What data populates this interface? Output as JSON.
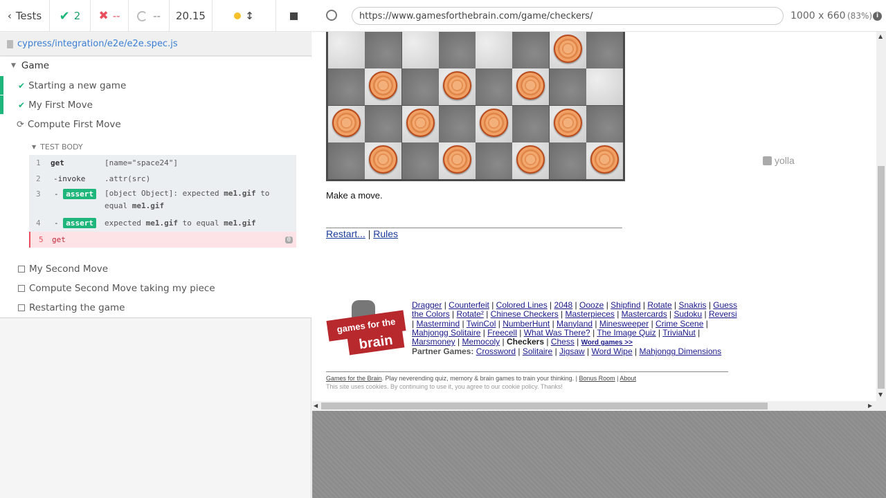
{
  "runner": {
    "tests_label": "Tests",
    "passed_count": "2",
    "failed_count": "--",
    "pending_count": "--",
    "duration": "20.15",
    "spec_path": "cypress/integration/e2e/e2e.spec.js",
    "suite_title": "Game",
    "tests": [
      {
        "title": "Starting a new game"
      },
      {
        "title": "My First Move"
      },
      {
        "title": "Compute First Move"
      },
      {
        "title": "My Second Move"
      },
      {
        "title": "Compute Second Move taking my piece"
      },
      {
        "title": "Restarting the game"
      }
    ],
    "test_body_label": "TEST BODY",
    "commands": [
      {
        "num": "1",
        "name": "get",
        "msg": "[name=\"space24\"]"
      },
      {
        "num": "2",
        "name": "-invoke",
        "msg": ".attr(src)"
      },
      {
        "num": "3",
        "badge": "assert",
        "msg_parts": [
          "[object Object]: expected",
          "me1.gif",
          "to",
          "equal",
          "me1.gif"
        ]
      },
      {
        "num": "4",
        "badge": "assert",
        "msg_parts": [
          "expected",
          "me1.gif",
          "to equal",
          "me1.gif"
        ]
      },
      {
        "num": "5",
        "name": "get",
        "count": "0"
      }
    ]
  },
  "aut": {
    "url": "https://www.gamesforthebrain.com/game/checkers/",
    "viewport_size": "1000 x 660",
    "scale": "(83%)",
    "status": "Make a move.",
    "restart_link": "Restart...",
    "separator": "|",
    "rules_link": "Rules",
    "ad_label": "yolla",
    "logo_text": [
      "games for the",
      "brain"
    ],
    "game_links": [
      "Dragger",
      "Counterfeit",
      "Colored Lines",
      "2048",
      "Oooze",
      "Shipfind",
      "Rotate",
      "Snakris",
      "Guess the Colors",
      "Rotate²",
      "Chinese Checkers",
      "Masterpieces",
      "Mastercards",
      "Sudoku",
      "Reversi",
      "Mastermind",
      "TwinCol",
      "NumberHunt",
      "Manyland",
      "Minesweeper",
      "Crime Scene",
      "Mahjongg Solitaire",
      "Freecell",
      "What Was There?",
      "The Image Quiz",
      "TriviaNut",
      "Marsmoney",
      "Memocoly"
    ],
    "current_game": "Checkers",
    "chess_link": "Chess",
    "word_games_link": "Word games >>",
    "partner_label": "Partner Games:",
    "partner_links": [
      "Crossword",
      "Solitaire",
      "Jigsaw",
      "Word Wipe",
      "Mahjongg Dimensions"
    ],
    "footer_site_link": "Games for the Brain",
    "footer_text": ". Play neverending quiz, memory & brain games to train your thinking. |",
    "footer_bonus": "Bonus Room",
    "footer_about": "About",
    "cookie_text": "This site uses cookies. By continuing to use it, you agree to our cookie policy. Thanks!"
  },
  "board": {
    "pieces": [
      [
        0,
        6
      ],
      [
        1,
        1
      ],
      [
        1,
        3
      ],
      [
        1,
        5
      ],
      [
        2,
        0
      ],
      [
        2,
        2
      ],
      [
        2,
        4
      ],
      [
        2,
        6
      ],
      [
        3,
        1
      ],
      [
        3,
        3
      ],
      [
        3,
        5
      ],
      [
        3,
        7
      ]
    ]
  }
}
